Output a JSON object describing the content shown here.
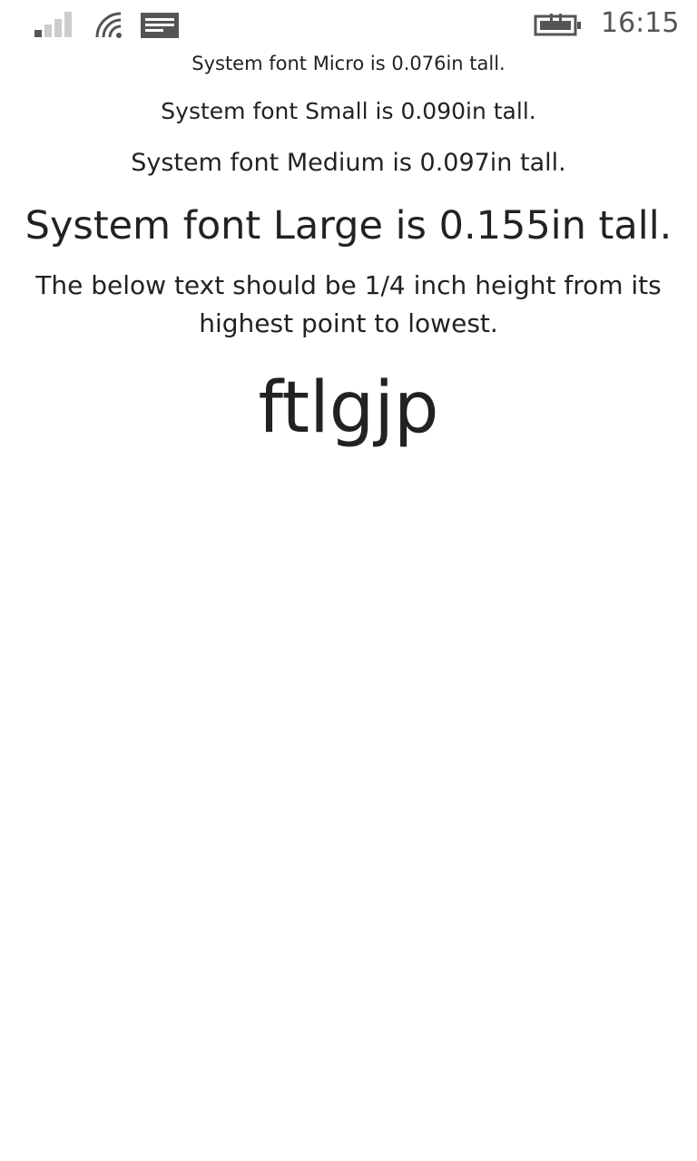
{
  "status_bar": {
    "time": "16:15",
    "icons": {
      "signal": "signal-strength-icon",
      "wifi": "wifi-icon",
      "message": "message-icon",
      "battery": "battery-charging-icon"
    },
    "icon_color": "#555555"
  },
  "content": {
    "micro_label": "System font Micro is 0.076in tall.",
    "small_label": "System font Small is 0.090in tall.",
    "medium_label": "System font Medium is 0.097in tall.",
    "large_label": "System font Large is 0.155in tall.",
    "note": "The below text should be 1/4 inch height from its highest point to lowest.",
    "sample_text": "ftlgjp"
  },
  "colors": {
    "background": "#ffffff",
    "text": "#222222"
  }
}
